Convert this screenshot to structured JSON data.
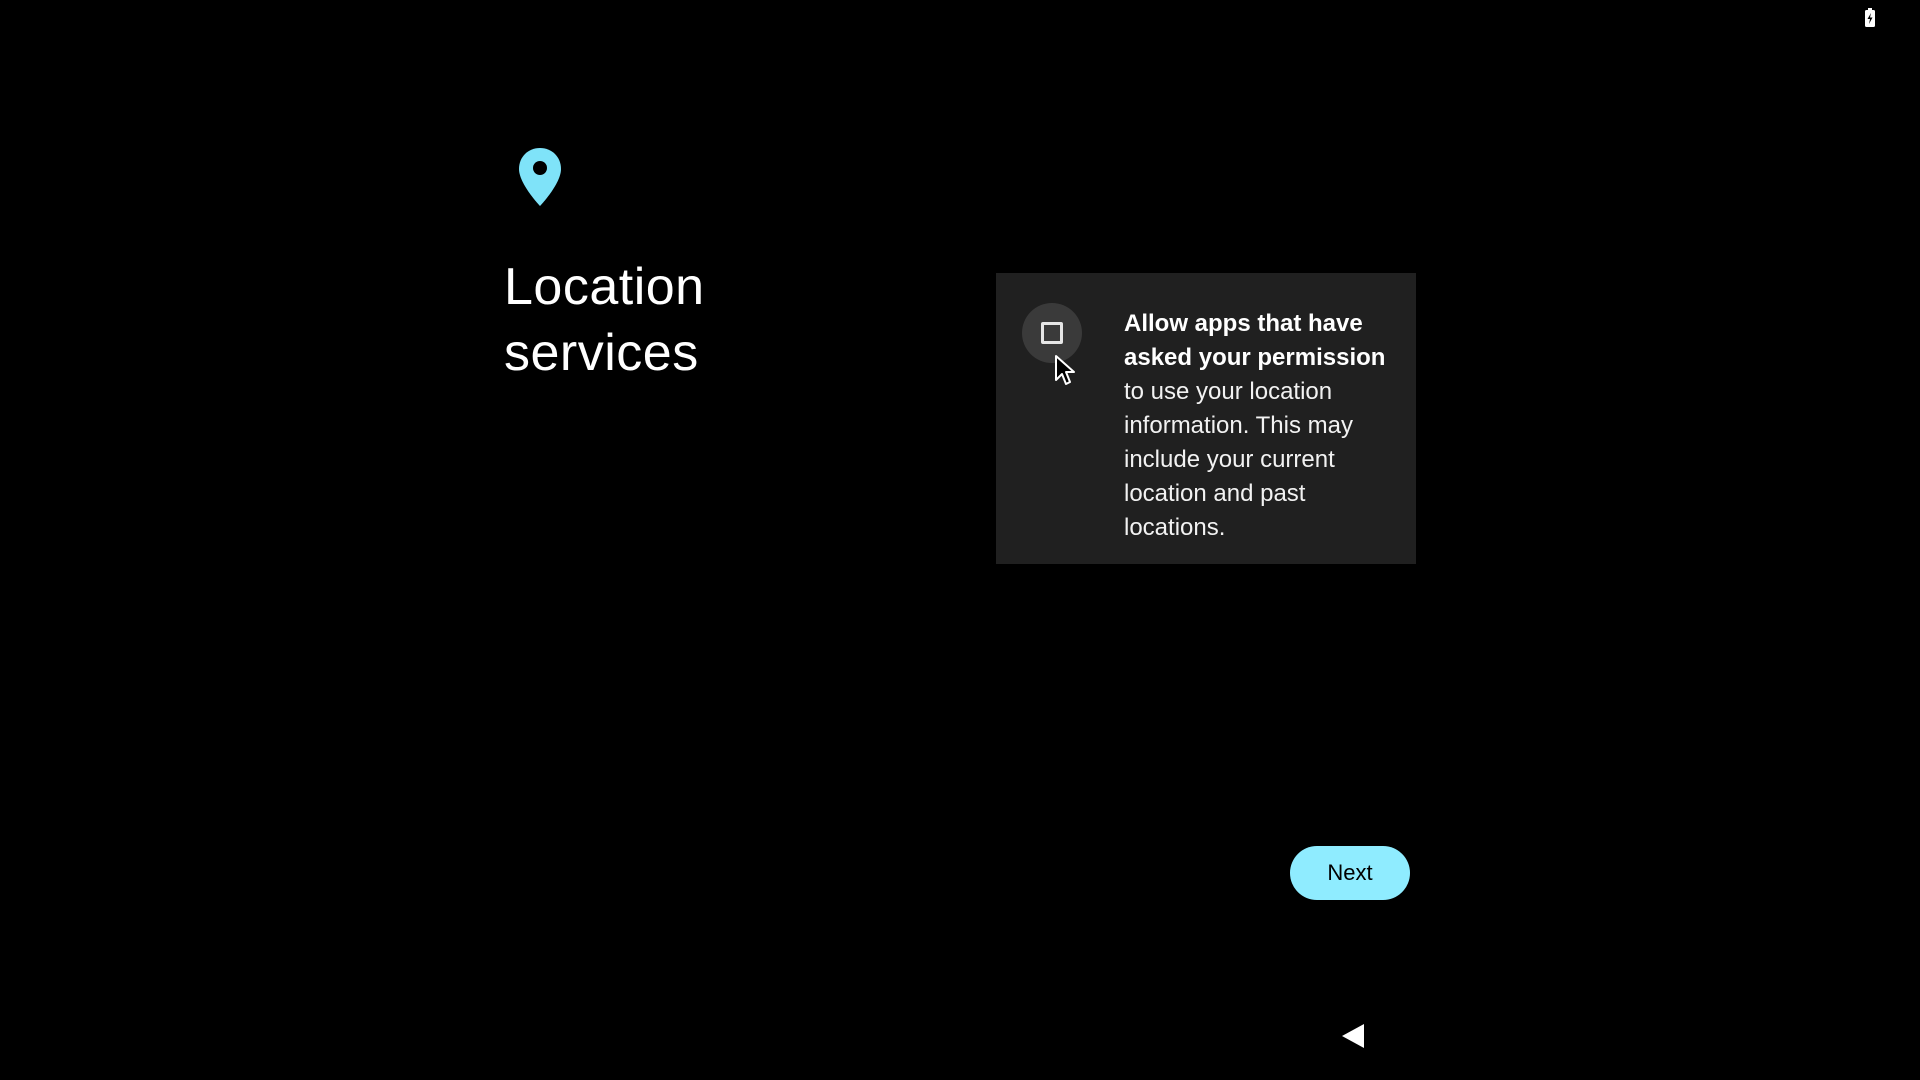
{
  "status_bar": {
    "battery_icon": "battery-charging-icon"
  },
  "header": {
    "icon": "location-pin-icon",
    "title": "Location services"
  },
  "option": {
    "checked": false,
    "text_bold": "Allow apps that have asked your permission",
    "text_rest": " to use your location information. This may include your current location and past locations."
  },
  "actions": {
    "next_label": "Next"
  },
  "nav": {
    "back_icon": "back-triangle-icon"
  },
  "colors": {
    "accent": "#8fecff",
    "card_background": "#202020",
    "background": "#000000"
  }
}
